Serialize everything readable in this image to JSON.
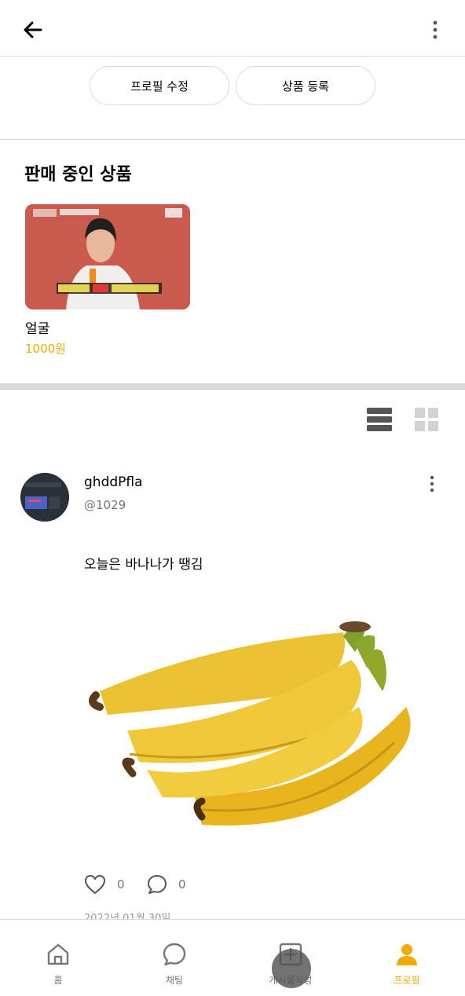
{
  "header": {
    "back_icon": "arrow-left-icon",
    "more_icon": "vertical-dots-icon"
  },
  "actions": {
    "edit_profile": "프로필 수정",
    "add_product": "상품 등록"
  },
  "sale": {
    "title": "판매 중인 상품",
    "products": [
      {
        "name": "얼굴",
        "price": "1000원"
      }
    ]
  },
  "view_toggle": {
    "list_icon": "list-view-icon",
    "grid_icon": "grid-view-icon"
  },
  "post": {
    "username": "ghddPfla",
    "handle": "@1029",
    "text": "오늘은 바나나가 땡김",
    "like_count": "0",
    "comment_count": "0",
    "date": "2022년 01월 30일"
  },
  "tabs": [
    {
      "label": "홈",
      "icon": "home-icon"
    },
    {
      "label": "채팅",
      "icon": "chat-icon"
    },
    {
      "label": "게시물작성",
      "icon": "add-post-icon"
    },
    {
      "label": "프로필",
      "icon": "profile-icon",
      "active": true
    }
  ],
  "colors": {
    "accent": "#f2a900",
    "gray_text": "#767676",
    "border": "#dbdbdb"
  }
}
